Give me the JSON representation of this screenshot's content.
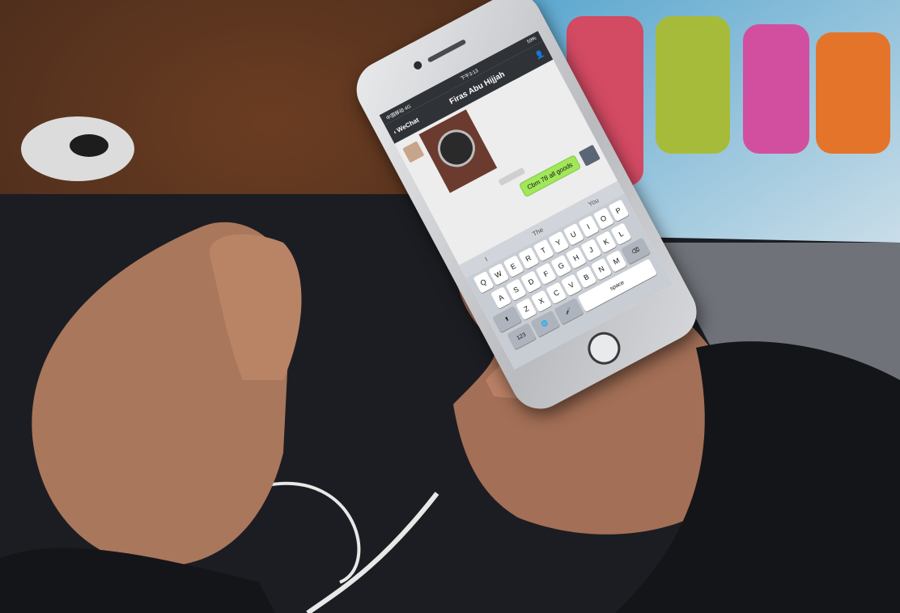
{
  "status_bar": {
    "carrier": "中国移动 4G",
    "time": "下午3:13",
    "battery": "59%"
  },
  "nav": {
    "back_label": "WeChat",
    "title": "Firas Abu Hijjah",
    "profile_icon": "person-icon"
  },
  "chat": {
    "outgoing_message": "Cbm 78 all goods"
  },
  "suggestions": [
    "I",
    "The",
    "You"
  ],
  "keyboard": {
    "row1": [
      "Q",
      "W",
      "E",
      "R",
      "T",
      "Y",
      "U",
      "I",
      "O",
      "P"
    ],
    "row2": [
      "A",
      "S",
      "D",
      "F",
      "G",
      "H",
      "J",
      "K",
      "L"
    ],
    "row3": [
      "Z",
      "X",
      "C",
      "V",
      "B",
      "N",
      "M"
    ],
    "numbers_key": "123",
    "space_key": "space"
  },
  "colors": {
    "wechat_bubble": "#a0e75a",
    "nav_bar": "#2f3237"
  }
}
